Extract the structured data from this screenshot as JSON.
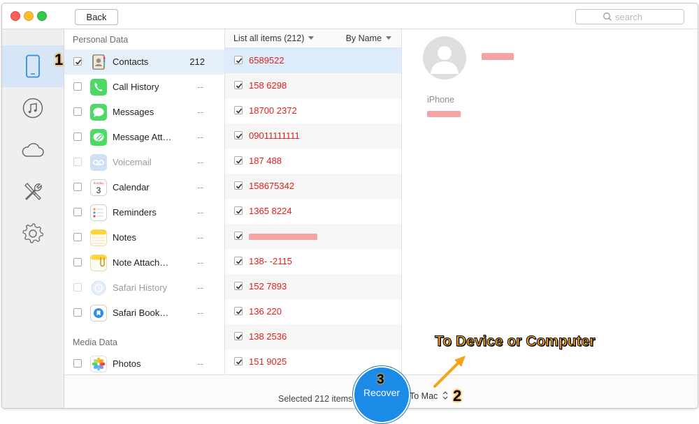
{
  "window": {
    "back_label": "Back",
    "search_placeholder": "search"
  },
  "sidebar": {
    "items": [
      {
        "name": "device-icon",
        "active": true
      },
      {
        "name": "music-icon",
        "active": false
      },
      {
        "name": "cloud-icon",
        "active": false
      },
      {
        "name": "tools-icon",
        "active": false
      },
      {
        "name": "settings-icon",
        "active": false
      }
    ]
  },
  "categories": {
    "personal_label": "Personal Data",
    "media_label": "Media Data",
    "items": [
      {
        "label": "Contacts",
        "count": "212",
        "checked": true,
        "disabled": false,
        "icon": "contacts-icon"
      },
      {
        "label": "Call History",
        "count": "--",
        "checked": false,
        "disabled": false,
        "icon": "phone-icon"
      },
      {
        "label": "Messages",
        "count": "--",
        "checked": false,
        "disabled": false,
        "icon": "messages-icon"
      },
      {
        "label": "Message Att…",
        "count": "--",
        "checked": false,
        "disabled": false,
        "icon": "message-attachment-icon"
      },
      {
        "label": "Voicemail",
        "count": "--",
        "checked": false,
        "disabled": true,
        "icon": "voicemail-icon"
      },
      {
        "label": "Calendar",
        "count": "--",
        "checked": false,
        "disabled": false,
        "icon": "calendar-icon"
      },
      {
        "label": "Reminders",
        "count": "--",
        "checked": false,
        "disabled": false,
        "icon": "reminders-icon"
      },
      {
        "label": "Notes",
        "count": "--",
        "checked": false,
        "disabled": false,
        "icon": "notes-icon"
      },
      {
        "label": "Note Attach…",
        "count": "--",
        "checked": false,
        "disabled": false,
        "icon": "note-attachment-icon"
      },
      {
        "label": "Safari History",
        "count": "--",
        "checked": false,
        "disabled": true,
        "icon": "safari-history-icon"
      },
      {
        "label": "Safari Book…",
        "count": "--",
        "checked": false,
        "disabled": false,
        "icon": "safari-bookmark-icon"
      }
    ],
    "media_items": [
      {
        "label": "Photos",
        "count": "--",
        "checked": false,
        "disabled": false,
        "icon": "photos-icon"
      }
    ]
  },
  "list": {
    "header_left": "List all items (212)",
    "header_right": "By Name",
    "items": [
      "6589522",
      "158      6298",
      "18700  2372",
      "09011111111",
      "187      488",
      "158675342",
      "1365      8224",
      "",
      "138-      -2115",
      "152      7893",
      "136      220",
      "138      2536",
      "151      9025"
    ]
  },
  "detail": {
    "label": "iPhone"
  },
  "bottom": {
    "selected_text": "Selected 212 items",
    "recover_label": "Recover",
    "destination": "To Mac"
  },
  "annotations": {
    "step1": "1",
    "step2": "2",
    "step3": "3",
    "title": "To Device or Computer"
  },
  "colors": {
    "accent": "#1c8be8",
    "item_text": "#e0201b",
    "annotation": "#f7a21b"
  }
}
